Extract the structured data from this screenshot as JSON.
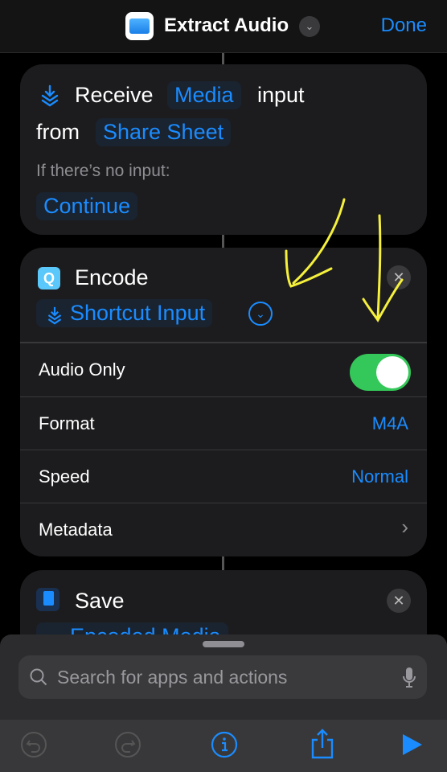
{
  "nav": {
    "title": "Extract Audio",
    "done_label": "Done",
    "app_icon": "files-folder-icon"
  },
  "receive": {
    "word1": "Receive",
    "type_token": "Media",
    "word2": "input",
    "from": "from",
    "source_token": "Share Sheet",
    "no_input_label": "If there’s no input:",
    "no_input_action": "Continue"
  },
  "encode": {
    "title": "Encode",
    "input_token": "Shortcut Input",
    "rows": [
      {
        "label": "Audio Only",
        "toggle_on": true
      },
      {
        "label": "Format",
        "value": "M4A"
      },
      {
        "label": "Speed",
        "value": "Normal"
      },
      {
        "label": "Metadata"
      }
    ]
  },
  "save": {
    "title": "Save",
    "input_token": "Encoded Media"
  },
  "search": {
    "placeholder": "Search for apps and actions"
  },
  "colors": {
    "accent": "#1a8cff",
    "toggle": "#34c759",
    "annotation": "#f5f03c"
  }
}
